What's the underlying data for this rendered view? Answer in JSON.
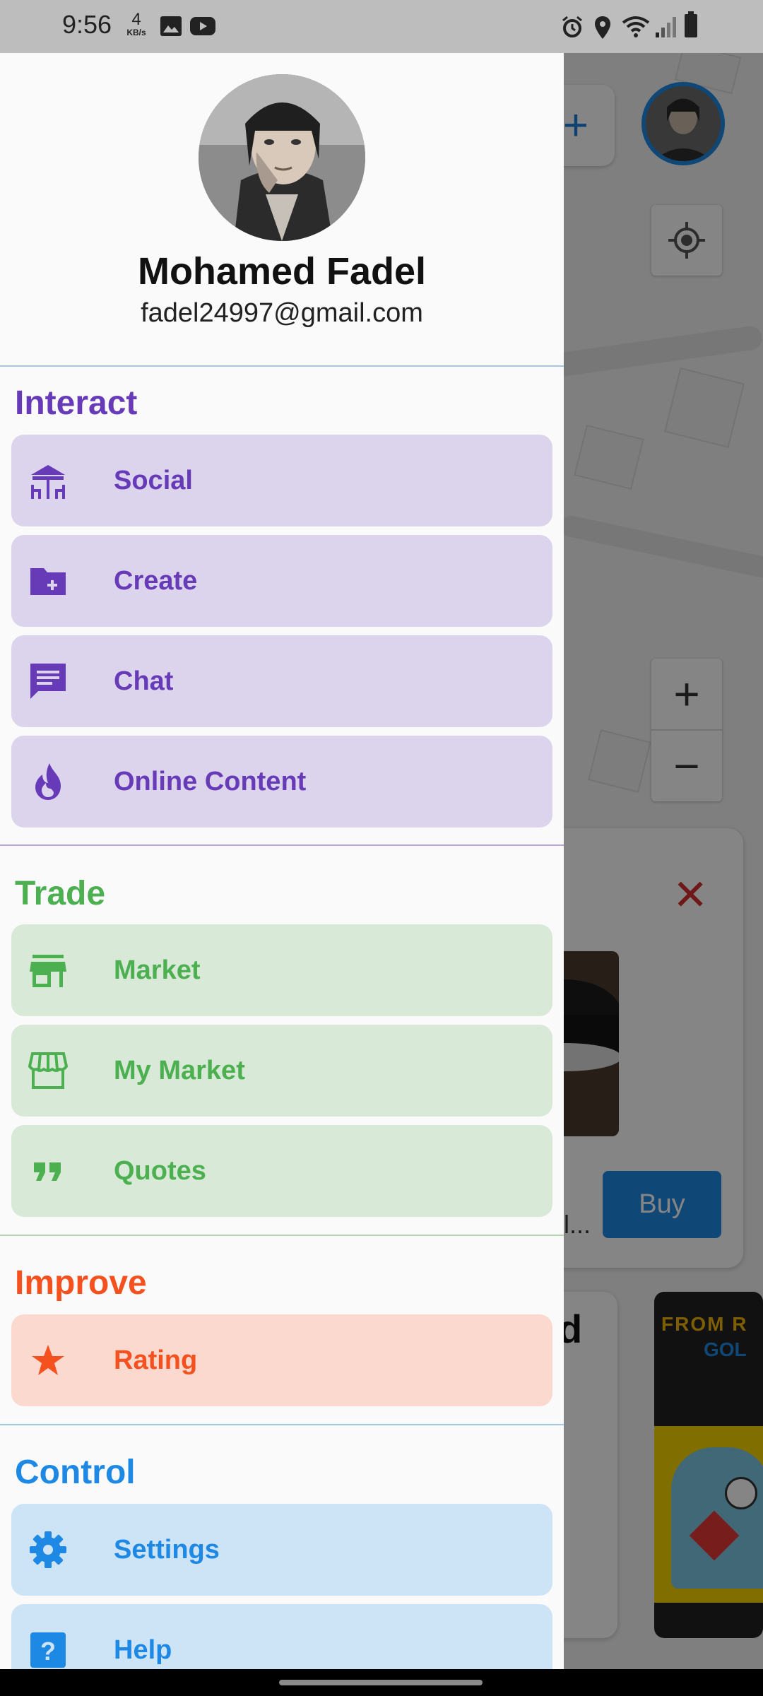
{
  "status_bar": {
    "time": "9:56",
    "net_speed_value": "4",
    "net_speed_unit": "KB/s",
    "icons": [
      "image-icon",
      "youtube-icon",
      "alarm-icon",
      "location-icon",
      "wifi-icon",
      "signal-icon",
      "battery-icon"
    ]
  },
  "background": {
    "add_button": "+",
    "zoom_in": "+",
    "zoom_out": "−",
    "close_symbol": "✕",
    "buy_button": "Buy",
    "truncated_text": "il...",
    "partial_heading": "d",
    "book_line1": "FROM R",
    "book_line2": "GOL"
  },
  "profile": {
    "name": "Mohamed Fadel",
    "email": "fadel24997@gmail.com"
  },
  "sections": [
    {
      "title": "Interact",
      "color": "#673ab7",
      "items": [
        {
          "label": "Social",
          "icon": "social-table-icon"
        },
        {
          "label": "Create",
          "icon": "create-folder-plus-icon"
        },
        {
          "label": "Chat",
          "icon": "chat-icon"
        },
        {
          "label": "Online Content",
          "icon": "fire-icon"
        }
      ]
    },
    {
      "title": "Trade",
      "color": "#4caf50",
      "items": [
        {
          "label": "Market",
          "icon": "store-icon"
        },
        {
          "label": "My Market",
          "icon": "storefront-icon"
        },
        {
          "label": "Quotes",
          "icon": "quote-icon"
        }
      ]
    },
    {
      "title": "Improve",
      "color": "#f4511e",
      "items": [
        {
          "label": "Rating",
          "icon": "star-icon"
        }
      ]
    },
    {
      "title": "Control",
      "color": "#1e88e5",
      "items": [
        {
          "label": "Settings",
          "icon": "gear-icon"
        },
        {
          "label": "Help",
          "icon": "help-icon"
        }
      ]
    }
  ]
}
